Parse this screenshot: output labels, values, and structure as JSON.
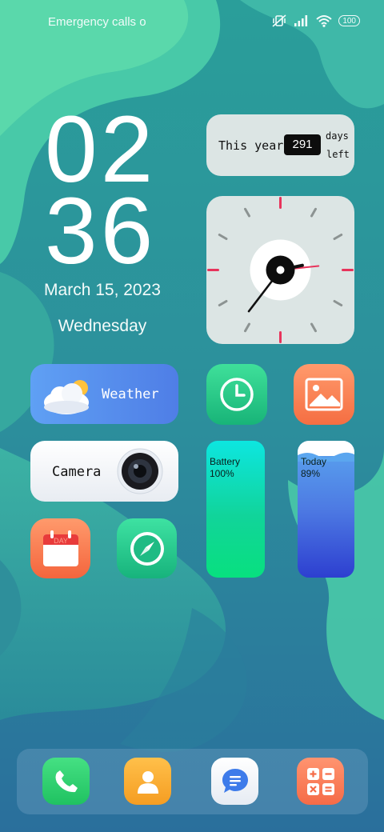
{
  "status_bar": {
    "carrier_text": "Emergency calls o",
    "battery_level": "100",
    "icons": [
      "mute-vibrate-icon",
      "signal-icon",
      "wifi-icon",
      "battery-icon"
    ]
  },
  "clock": {
    "hours": "02",
    "minutes": "36",
    "date": "March 15, 2023",
    "weekday": "Wednesday"
  },
  "countdown_widget": {
    "label": "This year",
    "days_value": "291",
    "days_label": "days",
    "left_label": "left"
  },
  "analog_clock": {
    "hour": 2,
    "minute": 36,
    "second": 14
  },
  "widgets": {
    "weather_label": "Weather",
    "camera_label": "Camera",
    "battery_label": "Battery",
    "battery_value": "100%",
    "battery_fraction": 1.0,
    "today_label": "Today",
    "today_value": "89%",
    "today_fraction": 0.89
  },
  "apps": [
    "clock-app",
    "gallery-app",
    "calendar-app",
    "compass-app"
  ],
  "calendar_icon_text": "DAY",
  "dock": [
    "phone",
    "contacts",
    "messages",
    "calculator"
  ],
  "colors": {
    "accent_red": "#e8335b",
    "widget_bg": "#dce5e4"
  }
}
